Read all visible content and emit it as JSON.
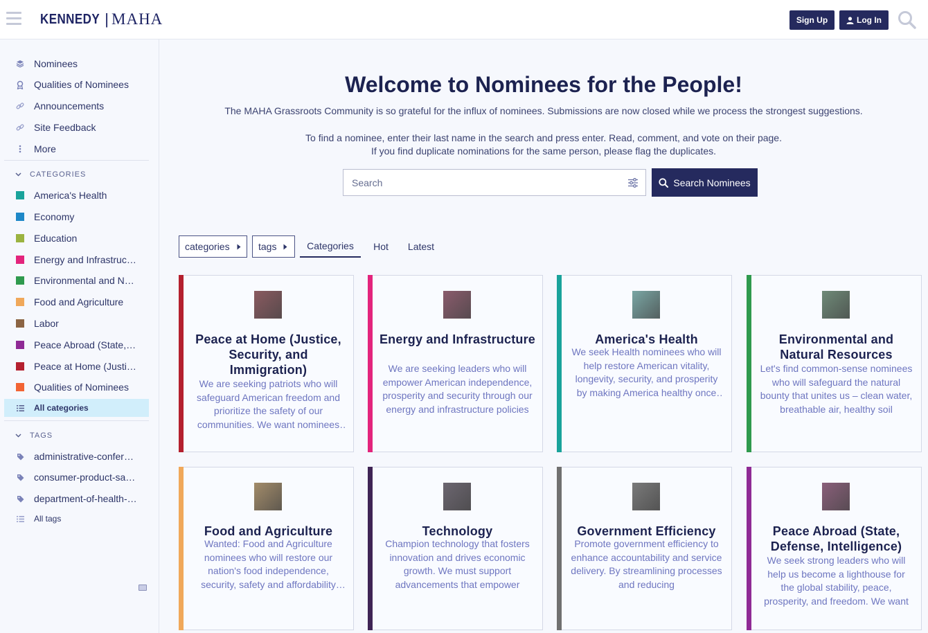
{
  "header": {
    "logo_left": "KENNEDY",
    "logo_sep": "|",
    "logo_right": "MAHA",
    "signup_label": "Sign Up",
    "login_label": "Log In"
  },
  "sidebar": {
    "nav": [
      {
        "label": "Nominees",
        "icon": "layers-icon"
      },
      {
        "label": "Qualities of Nominees",
        "icon": "award-icon"
      },
      {
        "label": "Announcements",
        "icon": "link-icon"
      },
      {
        "label": "Site Feedback",
        "icon": "link-icon"
      },
      {
        "label": "More",
        "icon": "vertical-ellipsis-icon"
      }
    ],
    "categories_heading": "CATEGORIES",
    "categories": [
      {
        "label": "America's Health",
        "color": "#1aa39b"
      },
      {
        "label": "Economy",
        "color": "#1e88c8"
      },
      {
        "label": "Education",
        "color": "#9bb340"
      },
      {
        "label": "Energy and Infrastructure",
        "color": "#e3247c"
      },
      {
        "label": "Environmental and Natural Resources",
        "color": "#2f9a4e"
      },
      {
        "label": "Food and Agriculture",
        "color": "#f0a85a"
      },
      {
        "label": "Labor",
        "color": "#8b6443"
      },
      {
        "label": "Peace Abroad (State, Defense, Intelligence)",
        "color": "#8f2a95"
      },
      {
        "label": "Peace at Home (Justice, Security, and Immigration)",
        "color": "#b4202f"
      },
      {
        "label": "Qualities of Nominees",
        "color": "#f26434"
      }
    ],
    "all_categories": "All categories",
    "tags_heading": "TAGS",
    "tags": [
      {
        "label": "administrative-conference"
      },
      {
        "label": "consumer-product-safety"
      },
      {
        "label": "department-of-health-and-human-services"
      }
    ],
    "all_tags": "All tags"
  },
  "main": {
    "title": "Welcome to Nominees for the People!",
    "intro_1": "The MAHA Grassroots Community is so grateful for the influx of nominees. Submissions are now closed while we process the strongest suggestions.",
    "intro_2": "To find a nominee, enter their last name in the search and press enter. Read, comment, and vote on their page.",
    "intro_3": "If you find duplicate nominations for the same person, please flag the duplicates.",
    "search_placeholder": "Search",
    "search_button": "Search Nominees",
    "nav": {
      "categories_dropdown": "categories",
      "tags_dropdown": "tags",
      "tabs": [
        "Categories",
        "Hot",
        "Latest"
      ],
      "active_tab": "Categories"
    },
    "cards": [
      {
        "title": "Peace at Home (Justice, Security, and Immigration)",
        "desc": "We are seeking patriots who will safeguard American freedom and prioritize the safety of our communities. We want nominees who will uphold justice",
        "color": "#b4202f",
        "thumb": "#8a5a60"
      },
      {
        "title": "Energy and Infrastructure",
        "desc": "We are seeking leaders who will empower American independence, prosperity and security through our energy and infrastructure policies",
        "color": "#e3247c",
        "thumb": "#8a5b6c"
      },
      {
        "title": "America's Health",
        "desc": "We seek Health nominees who will help restore American vitality, longevity, security, and prosperity by making America healthy once again",
        "color": "#1aa39b",
        "thumb": "#7aa6a4"
      },
      {
        "title": "Environmental and Natural Resources",
        "desc": "Let's find common-sense nominees who will safeguard the natural bounty that unites us – clean water, breathable air, healthy soil",
        "color": "#2f9a4e",
        "thumb": "#6f8a78"
      },
      {
        "title": "Food and Agriculture",
        "desc": "Wanted: Food and Agriculture nominees who will restore our nation's food independence, security, safety and affordability while",
        "color": "#f0a85a",
        "thumb": "#a38c6a"
      },
      {
        "title": "Technology",
        "desc": "Champion technology that fosters innovation and drives economic growth. We must support advancements that empower",
        "color": "#3f2455",
        "thumb": "#6c6670"
      },
      {
        "title": "Government Efficiency",
        "desc": "Promote government efficiency to enhance accountability and service delivery. By streamlining processes and reducing",
        "color": "#707070",
        "thumb": "#7a7a7a"
      },
      {
        "title": "Peace Abroad (State, Defense, Intelligence)",
        "desc": "We seek strong leaders who will help us become a lighthouse for the global stability, peace, prosperity, and freedom. We want",
        "color": "#8f2a95",
        "thumb": "#8a5f7a"
      }
    ]
  }
}
